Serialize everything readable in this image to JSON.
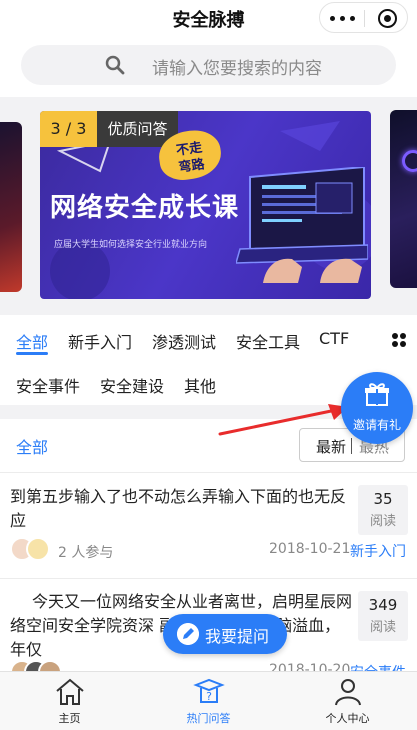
{
  "header": {
    "title": "安全脉搏"
  },
  "search": {
    "placeholder": "请输入您要搜索的内容"
  },
  "banner": {
    "counter": "3 / 3",
    "tag": "优质问答",
    "sticker_line1": "不走",
    "sticker_line2": "弯路",
    "headline": "网络安全成长课",
    "subline": "应届大学生如何选择安全行业就业方向"
  },
  "categories": {
    "row1": [
      "全部",
      "新手入门",
      "渗透测试",
      "安全工具",
      "CTF"
    ],
    "row2": [
      "安全事件",
      "安全建设",
      "其他"
    ]
  },
  "filter": {
    "all": "全部",
    "sort_new": "最新",
    "sort_hot": "最热"
  },
  "invite": {
    "label": "邀请有礼"
  },
  "questions": [
    {
      "text": "到第五步输入了也不动怎么弄输入下面的也无反应",
      "count": "35",
      "count_unit": "阅读",
      "participants": "2 人参与",
      "date": "2018-10-21",
      "category": "新手入门"
    },
    {
      "text": "今天又一位网络安全从业者离世，启明星辰网络空间安全学院资深 副院长 贺新朋，脑溢血，年仅",
      "count": "349",
      "count_unit": "阅读",
      "date": "2018-10-20",
      "category": "安全事件"
    }
  ],
  "ask_button": {
    "label": "我要提问"
  },
  "tabbar": {
    "items": [
      "主页",
      "热门问答",
      "个人中心"
    ]
  },
  "colors": {
    "accent": "#2b7df7",
    "banner": "#4b36c8",
    "tag_yellow": "#f6c23d"
  }
}
